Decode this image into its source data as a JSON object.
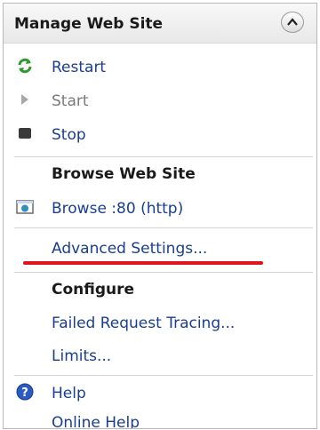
{
  "header": {
    "title": "Manage Web Site",
    "collapse_icon": "chevron-up-icon"
  },
  "manage": {
    "items": [
      {
        "label": "Restart",
        "icon": "restart-icon",
        "enabled": true
      },
      {
        "label": "Start",
        "icon": "start-icon",
        "enabled": false
      },
      {
        "label": "Stop",
        "icon": "stop-icon",
        "enabled": true
      }
    ]
  },
  "browse": {
    "heading": "Browse Web Site",
    "link": {
      "label": "Browse :80 (http)",
      "icon": "browser-icon"
    }
  },
  "advanced": {
    "label": "Advanced Settings..."
  },
  "configure": {
    "heading": "Configure",
    "items": [
      "Failed Request Tracing...",
      "Limits..."
    ]
  },
  "help": {
    "items": [
      {
        "label": "Help",
        "icon": "help-icon"
      },
      {
        "label": "Online Help",
        "icon": ""
      }
    ]
  },
  "colors": {
    "link": "#1a3e8f",
    "highlight_underline": "#e0141e",
    "restart_green": "#2e9a2e"
  }
}
